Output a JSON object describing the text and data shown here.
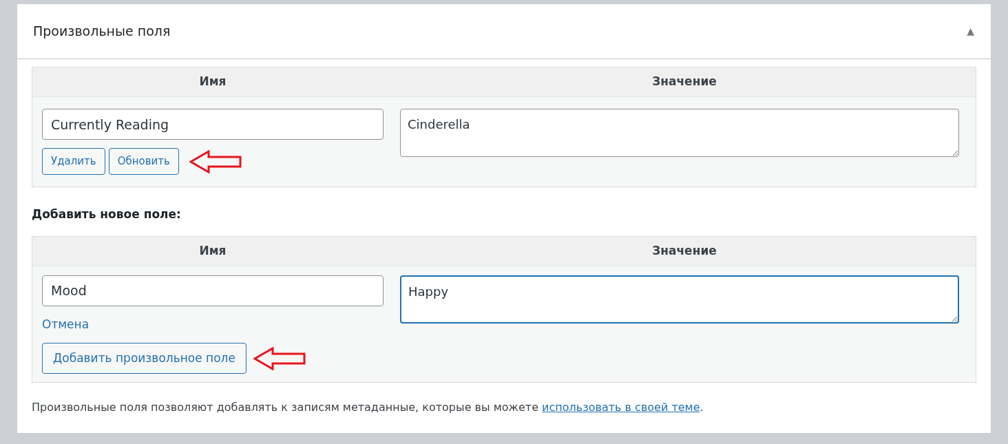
{
  "panel": {
    "title": "Произвольные поля",
    "collapse_toggle": "▲"
  },
  "existing_fields": {
    "columns": [
      "Имя",
      "Значение"
    ],
    "rows": [
      {
        "name": "Currently Reading",
        "value": "Cinderella",
        "value_focused": false,
        "buttons": [
          "Удалить",
          "Обновить"
        ],
        "annotated": true
      }
    ]
  },
  "new_field": {
    "heading": "Добавить новое поле:",
    "columns": [
      "Имя",
      "Значение"
    ],
    "name": "Mood",
    "value": "Happy",
    "value_focused": true,
    "cancel_link": "Отмена",
    "submit_button": "Добавить произвольное поле",
    "annotated": true
  },
  "footer": {
    "text": "Произвольные поля позволяют добавлять к записям метаданные, которые вы можете ",
    "link": "использовать в своей теме",
    "text_after": "."
  }
}
